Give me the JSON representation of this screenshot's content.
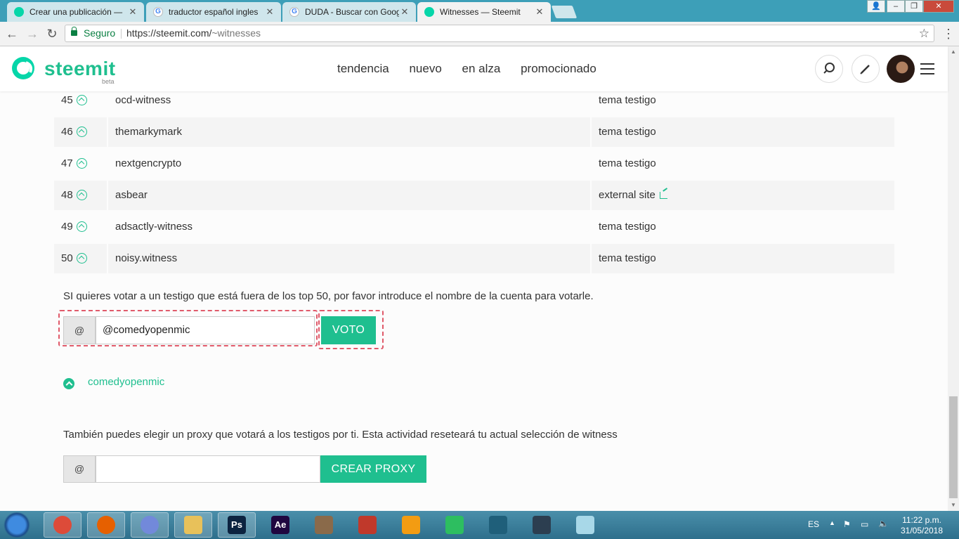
{
  "browser": {
    "tabs": [
      {
        "title": "Crear una publicación —",
        "icon": "steemit-favicon"
      },
      {
        "title": "traductor español ingles",
        "icon": "google-favicon"
      },
      {
        "title": "DUDA - Buscar con Goog",
        "icon": "google-favicon"
      },
      {
        "title": "Witnesses — Steemit",
        "icon": "steemit-favicon",
        "active": true
      }
    ],
    "secure_label": "Seguro",
    "url_main": "https://steemit.com/",
    "url_path": "~witnesses"
  },
  "header": {
    "logo": "steemit",
    "beta": "beta",
    "nav": [
      "tendencia",
      "nuevo",
      "en alza",
      "promocionado"
    ]
  },
  "witnesses": [
    {
      "rank": "45",
      "name": "ocd-witness",
      "info": "tema testigo",
      "external": false
    },
    {
      "rank": "46",
      "name": "themarkymark",
      "info": "tema testigo",
      "external": false
    },
    {
      "rank": "47",
      "name": "nextgencrypto",
      "info": "tema testigo",
      "external": false
    },
    {
      "rank": "48",
      "name": "asbear",
      "info": "external site",
      "external": true
    },
    {
      "rank": "49",
      "name": "adsactly-witness",
      "info": "tema testigo",
      "external": false
    },
    {
      "rank": "50",
      "name": "noisy.witness",
      "info": "tema testigo",
      "external": false
    }
  ],
  "vote": {
    "intro": "SI quieres votar a un testigo que está fuera de los top 50, por favor introduce el nombre de la cuenta para votarle.",
    "at": "@",
    "value": "@comedyopenmic",
    "button": "VOTO",
    "voted_name": "comedyopenmic"
  },
  "proxy": {
    "text": "También puedes elegir un proxy que votará a los testigos por ti. Esta actividad reseteará tu actual selección de witness",
    "at": "@",
    "value": "",
    "button": "CREAR PROXY"
  },
  "taskbar": {
    "lang": "ES",
    "time": "11:22 p.m.",
    "date": "31/05/2018",
    "apps": [
      "chrome",
      "firefox",
      "discord",
      "file-explorer",
      "photoshop",
      "after-effects",
      "gimp",
      "ccleaner",
      "fl-studio",
      "evernote",
      "app",
      "filmora",
      "notepad"
    ]
  },
  "colors": {
    "accent": "#1fbf8f",
    "highlight": "#e05a6a"
  }
}
